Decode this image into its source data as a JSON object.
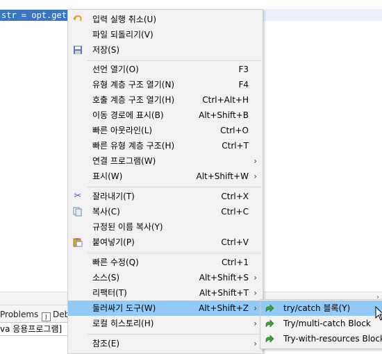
{
  "editor": {
    "selected_code": "str = opt.get(",
    "views": [
      "Problems",
      "Deb"
    ],
    "console_title": "va 응용프로그램]"
  },
  "menu": {
    "items": [
      {
        "label": "입력 실행 취소(U)",
        "shortcut": "",
        "icon": "undo-icon"
      },
      {
        "label": "파일 되돌리기(V)",
        "shortcut": ""
      },
      {
        "label": "저장(S)",
        "shortcut": "",
        "icon": "save-icon"
      },
      {
        "label": "선언 열기(O)",
        "shortcut": "F3"
      },
      {
        "label": "유형 계층 구조 열기(N)",
        "shortcut": "F4"
      },
      {
        "label": "호출 계층 구조 열기(H)",
        "shortcut": "Ctrl+Alt+H"
      },
      {
        "label": "이동 경로에 표시(B)",
        "shortcut": "Alt+Shift+B"
      },
      {
        "label": "빠른 아웃라인(L)",
        "shortcut": "Ctrl+O"
      },
      {
        "label": "빠른 유형 계층 구조(H)",
        "shortcut": "Ctrl+T"
      },
      {
        "label": "연결 프로그램(W)",
        "shortcut": ""
      },
      {
        "label": "표시(W)",
        "shortcut": "Alt+Shift+W"
      },
      {
        "label": "잘라내기(T)",
        "shortcut": "Ctrl+X",
        "icon": "cut-icon"
      },
      {
        "label": "복사(C)",
        "shortcut": "Ctrl+C",
        "icon": "copy-icon"
      },
      {
        "label": "규정된 이름 복사(Y)",
        "shortcut": ""
      },
      {
        "label": "붙여넣기(P)",
        "shortcut": "Ctrl+V",
        "icon": "paste-icon"
      },
      {
        "label": "빠른 수정(Q)",
        "shortcut": "Ctrl+1"
      },
      {
        "label": "소스(S)",
        "shortcut": "Alt+Shift+S"
      },
      {
        "label": "리팩터(T)",
        "shortcut": "Alt+Shift+T"
      },
      {
        "label": "둘러싸기 도구(W)",
        "shortcut": "Alt+Shift+Z"
      },
      {
        "label": "로컬 히스토리(H)",
        "shortcut": ""
      },
      {
        "label": "참조(E)",
        "shortcut": ""
      }
    ],
    "submenu_arrow": "›"
  },
  "submenu": {
    "items": [
      {
        "label": "try/catch 블록(Y)"
      },
      {
        "label": "Try/multi-catch Block"
      },
      {
        "label": "Try-with-resources Block"
      }
    ]
  },
  "colors": {
    "selection": "#3a75c4",
    "menu_bg": "#f2f2f2",
    "highlight": "#91c9f7",
    "line_highlight": "#e8f2fe"
  }
}
